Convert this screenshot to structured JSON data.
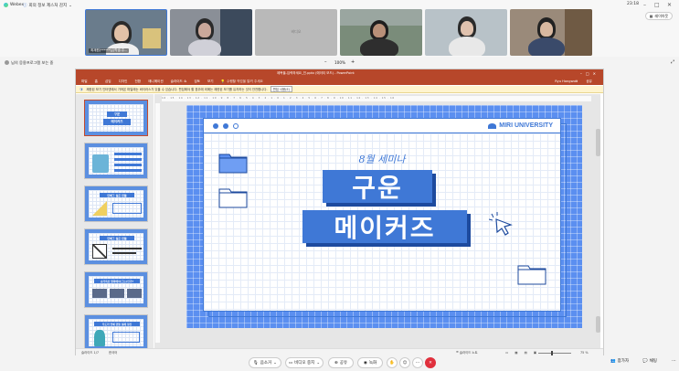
{
  "app": {
    "logo": "Webex",
    "meeting_info_label": "회의 정보",
    "reaction_label": "제스처 감지",
    "clock": "23:18"
  },
  "participants": [
    {
      "name": "최재원(******님(학생-주...",
      "color": "#6a7c8c"
    },
    {
      "name": "",
      "color": "#8a8f97"
    },
    {
      "name": "",
      "color": "#b9b9b9",
      "placeholder": "비디오"
    },
    {
      "name": "",
      "color": "#7a8c7a"
    },
    {
      "name": "",
      "color": "#b8c2c8"
    },
    {
      "name": "",
      "color": "#9a8a7a"
    }
  ],
  "layout_button": "레이아웃",
  "share": {
    "label": "님의 응용프로그램 보는 중",
    "zoom": "100%"
  },
  "ppt": {
    "title": "제목을-입력하세요_진.pptx (에이티 모드) - PowerPoint",
    "ribbon_tabs": [
      "파일",
      "홈",
      "삽입",
      "디자인",
      "전환",
      "애니메이션",
      "슬라이드 쇼",
      "검토",
      "보기",
      "수행할 작업을 알려 주세요"
    ],
    "share_label": "공유",
    "user_label": "Ryu Hongwon",
    "message": "제한된 보기 인터넷에서 가져온 파일에는 바이러스가 있을 수 있습니다. 편집해야 할 경우에 외에는 제한된 보기를 유지하는 것이 안전합니다.",
    "message_button": "편집 사용(E)",
    "thumbnails": [
      {
        "num": "1",
        "title_a": "구운",
        "title_b": "메이커즈"
      },
      {
        "num": "2",
        "title_a": "",
        "title_b": ""
      },
      {
        "num": "3",
        "title_a": "연예그 실은 만들",
        "title_b": ""
      },
      {
        "num": "4",
        "title_a": "연예그 실은 만들",
        "title_b": ""
      },
      {
        "num": "5",
        "title_a": "승가옥산 원화에서(그는)인가?",
        "title_b": ""
      },
      {
        "num": "6",
        "title_a": "우도리 연예 만들 설례 정신",
        "title_b": ""
      }
    ],
    "ruler_text": "16 · 15 · 14 · 13 · 12 · 11 · 10 · 9 · 8 · 7 · 6 · 5 · 4 · 3 · 2 · 1 · 0 · 1 · 2 · 3 · 4 · 5 · 6 · 7 · 8 · 9 · 10 · 11 · 12 · 13 · 14 · 15 · 16",
    "status_left": "슬라이드 1/7",
    "status_lang": "한국어",
    "status_notes": "슬라이드 노트",
    "status_zoom": "75 %"
  },
  "slide": {
    "logo_text": "MIRI UNIVERSITY",
    "subtitle": "8월 세미나",
    "title_line1": "구운",
    "title_line2": "메이커즈",
    "accent": "#3f78d6",
    "background": "#5b8ff0"
  },
  "controls": {
    "mute": "음소거",
    "video": "비디오 중지",
    "share": "공유",
    "record": "녹화",
    "more": "···",
    "participants": "참가자",
    "chat": "채팅"
  }
}
